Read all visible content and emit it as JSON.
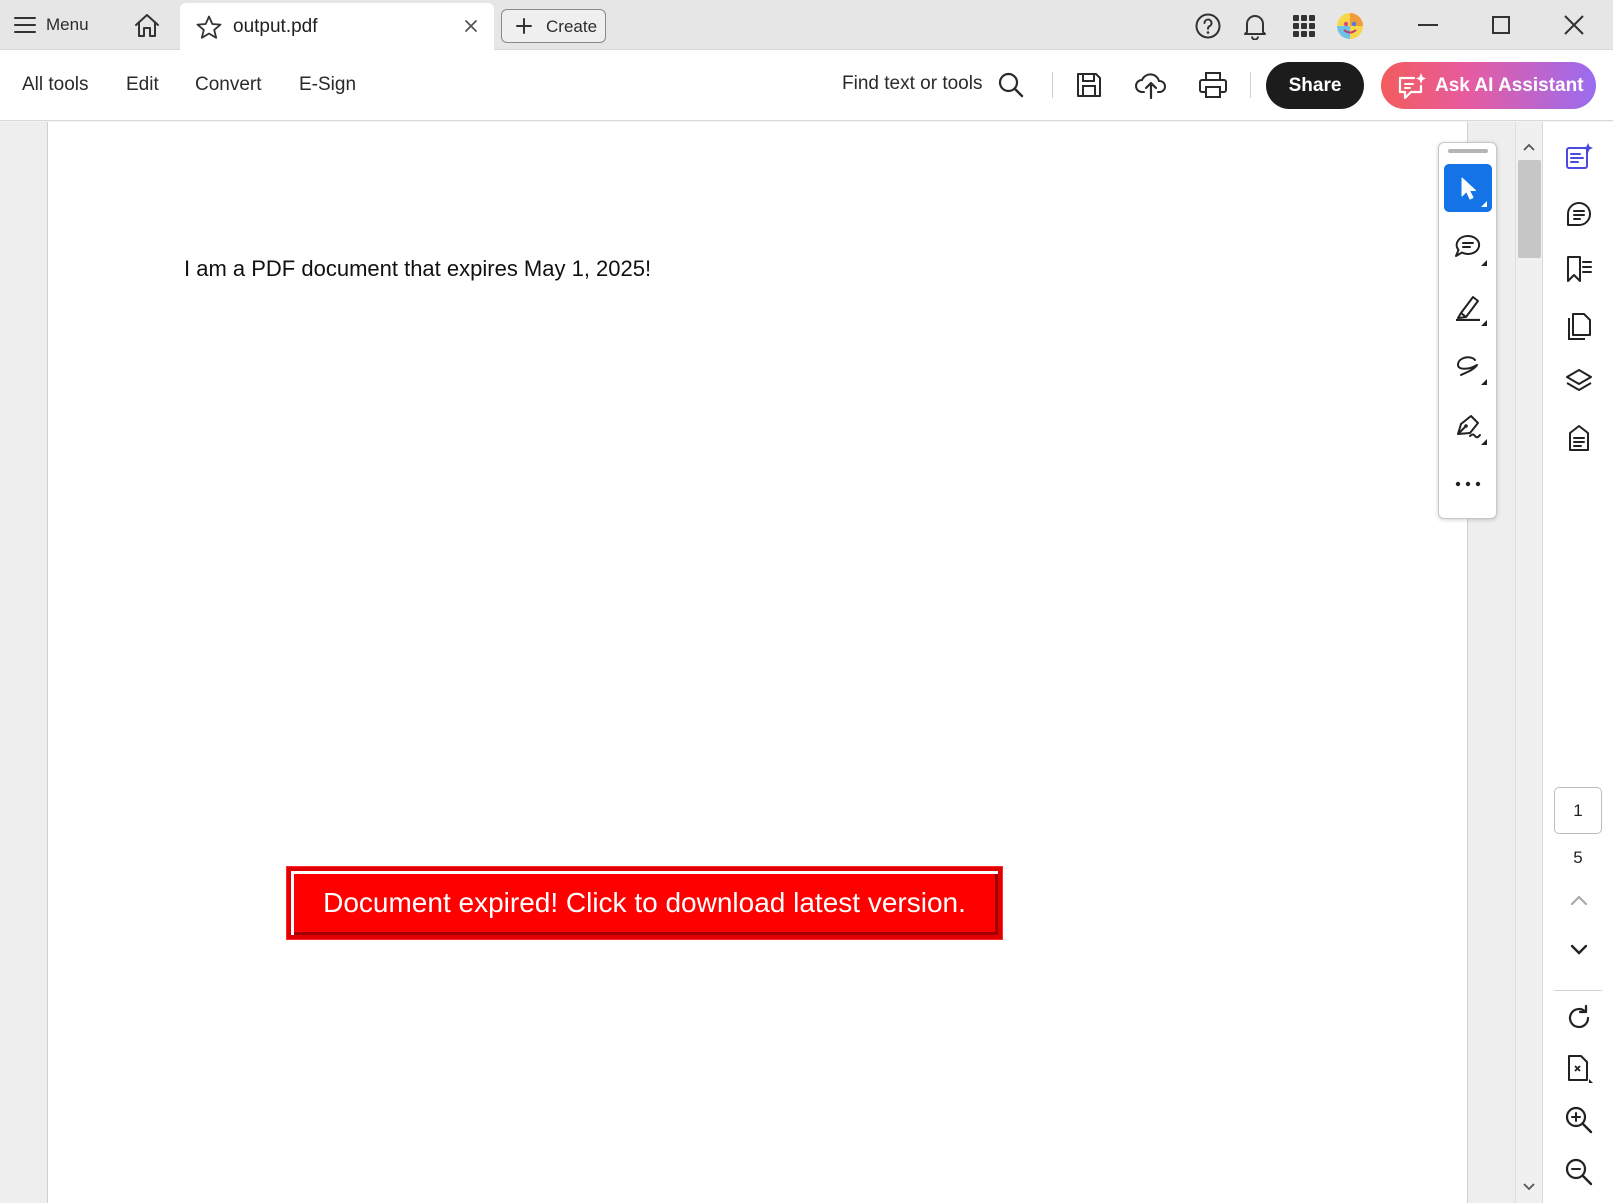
{
  "tabbar": {
    "menu_label": "Menu",
    "tab_title": "output.pdf",
    "create_label": "Create"
  },
  "toolbar": {
    "nav": [
      "All tools",
      "Edit",
      "Convert",
      "E-Sign"
    ],
    "find_label": "Find text or tools",
    "share_label": "Share",
    "ai_label": "Ask AI Assistant"
  },
  "document": {
    "body_text": "I am a PDF document that expires May 1, 2025!",
    "expired_button": "Document expired! Click to download latest version."
  },
  "pagination": {
    "current_page": "1",
    "total_pages": "5"
  },
  "colors": {
    "accent": "#1473e6",
    "expired_red": "#ff0000",
    "share_bg": "#1c1c1c",
    "ai_gradient_start": "#f25c5c",
    "ai_gradient_end": "#9a6cf0"
  },
  "icons": {
    "tabbar": [
      "menu-icon",
      "home-icon",
      "star-icon",
      "close-icon",
      "plus-icon",
      "help-icon",
      "bell-icon",
      "apps-grid-icon",
      "avatar-icon",
      "minimize-icon",
      "maximize-icon",
      "window-close-icon"
    ],
    "toolbar": [
      "search-icon",
      "save-icon",
      "cloud-upload-icon",
      "print-icon",
      "ai-sparkle-icon"
    ],
    "quick_tools": [
      "select-cursor-icon",
      "comment-icon",
      "highlight-pen-icon",
      "lasso-draw-icon",
      "sign-pen-icon",
      "more-icon"
    ],
    "rail": [
      "ai-panel-icon",
      "comments-panel-icon",
      "bookmarks-icon",
      "pages-icon",
      "layers-icon",
      "attachments-icon",
      "chevron-up-icon",
      "chevron-down-icon",
      "rotate-icon",
      "extract-page-icon",
      "zoom-in-icon",
      "zoom-out-icon"
    ]
  }
}
